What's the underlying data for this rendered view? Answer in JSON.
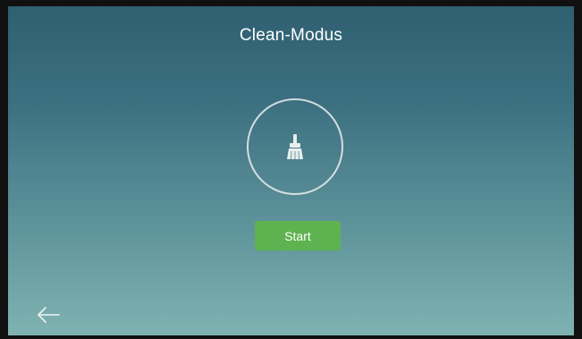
{
  "screen": {
    "title": "Clean-Modus",
    "mode_icon": "broom-icon",
    "start_label": "Start",
    "back_icon": "arrow-left-icon"
  },
  "colors": {
    "start_button": "#5fb250",
    "background_top": "#2f5f70",
    "background_bottom": "#7fb2b1",
    "icon_outline": "#ebf0f0",
    "text": "#ffffff"
  }
}
